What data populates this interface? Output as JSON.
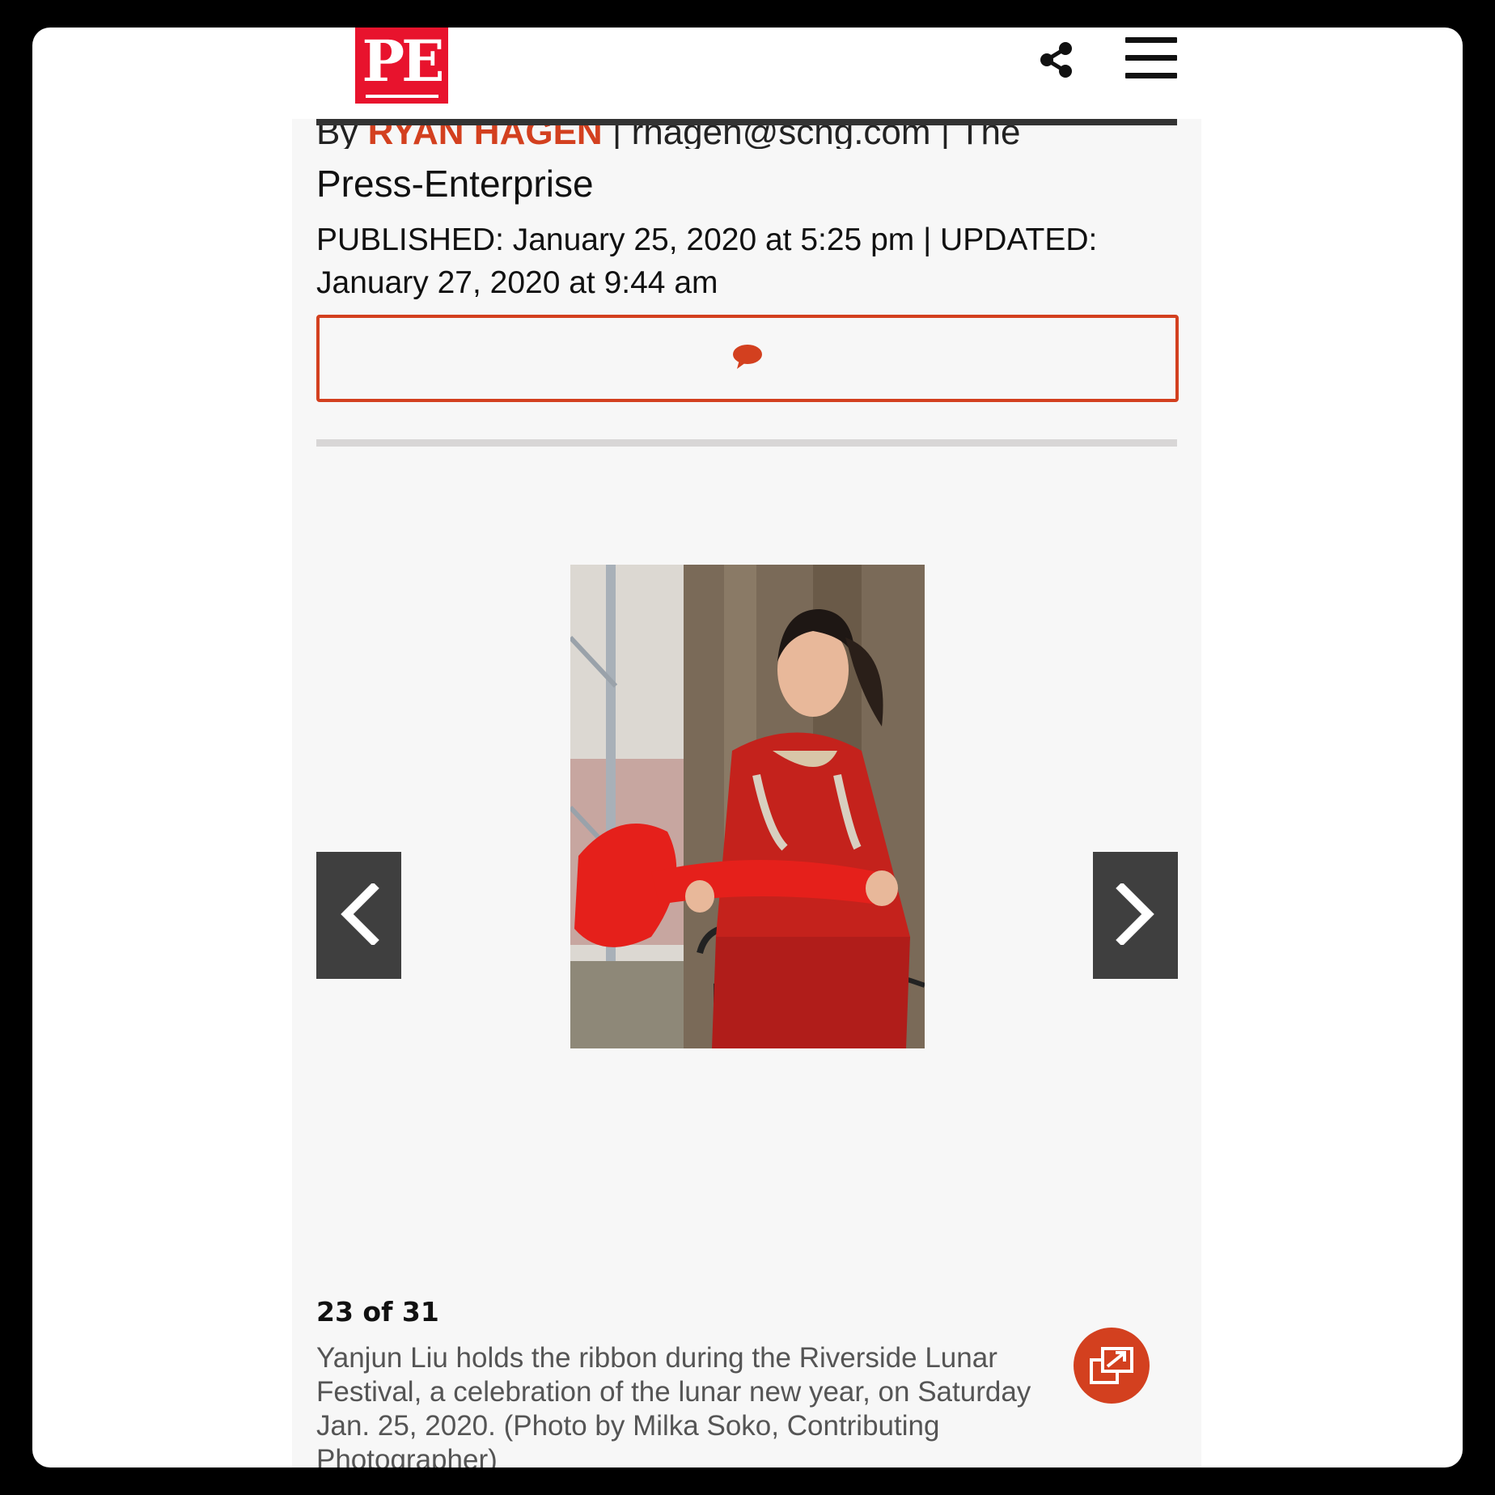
{
  "header": {
    "logo_text": "PE",
    "share_icon": "share-icon",
    "menu_icon": "hamburger-menu-icon"
  },
  "article": {
    "byline_prefix": "By ",
    "author": "RYAN HAGEN",
    "byline_suffix": " | rhagen@scng.com | The",
    "publisher": "Press-Enterprise",
    "dates": "PUBLISHED: January 25, 2020 at 5:25 pm | UPDATED: January 27, 2020 at 9:44 am",
    "comment_icon": "comment-bubble-icon"
  },
  "gallery": {
    "counter": "23 of 31",
    "caption": "Yanjun Liu holds the ribbon during the Riverside Lunar Festival, a celebration of the lunar new year, on Saturday Jan. 25, 2020. (Photo by Milka Soko, Contributing Photographer)",
    "prev_icon": "chevron-left-icon",
    "next_icon": "chevron-right-icon",
    "expand_icon": "expand-external-icon"
  },
  "colors": {
    "brand_red": "#e8132d",
    "accent_orange": "#d3401f",
    "nav_gray": "#3f3f3f"
  }
}
